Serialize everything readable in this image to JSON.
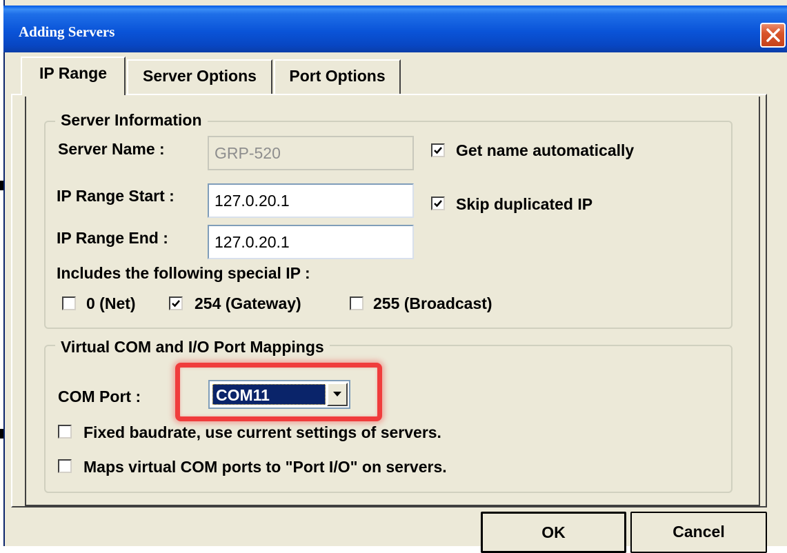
{
  "window": {
    "title": "Adding Servers",
    "close_icon": "close-icon"
  },
  "tabs": [
    {
      "label": "IP Range",
      "active": true
    },
    {
      "label": "Server Options",
      "active": false
    },
    {
      "label": "Port Options",
      "active": false
    }
  ],
  "server_info": {
    "group_label": "Server Information",
    "server_name_label": "Server Name :",
    "server_name_value": "GRP-520",
    "get_name_auto_label": "Get name automatically",
    "get_name_auto_checked": true,
    "ip_start_label": "IP Range Start :",
    "ip_start_value": "127.0.20.1",
    "skip_dup_label": "Skip duplicated IP",
    "skip_dup_checked": true,
    "ip_end_label": "IP Range End :",
    "ip_end_value": "127.0.20.1",
    "special_ip_label": "Includes the following special IP :",
    "special_ips": [
      {
        "label": "0 (Net)",
        "checked": false
      },
      {
        "label": "254 (Gateway)",
        "checked": true
      },
      {
        "label": "255 (Broadcast)",
        "checked": false
      }
    ]
  },
  "vcom": {
    "group_label": "Virtual COM and I/O Port Mappings",
    "com_port_label": "COM Port :",
    "com_port_value": "COM11",
    "fixed_baud_label": "Fixed baudrate, use current settings of servers.",
    "fixed_baud_checked": false,
    "map_port_io_label": "Maps virtual COM ports to \"Port I/O\" on servers.",
    "map_port_io_checked": false
  },
  "buttons": {
    "ok": "OK",
    "cancel": "Cancel"
  },
  "colors": {
    "dialog_bg": "#ece9d8",
    "titlebar": "#0a54d8",
    "highlight": "#f03c3c",
    "selection": "#0a246a"
  }
}
